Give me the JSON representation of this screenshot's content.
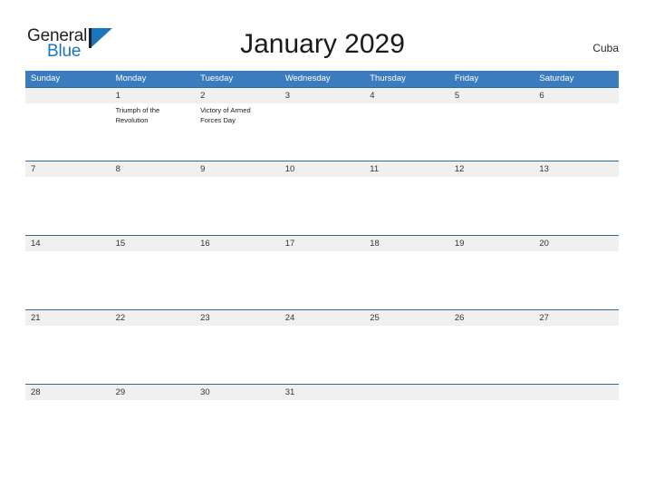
{
  "logo": {
    "word_one": "General",
    "word_two": "Blue",
    "mark_name": "blue-triangle-flag",
    "color_dark": "#231f20",
    "color_blue": "#1b75bc"
  },
  "header": {
    "title": "January 2029",
    "country": "Cuba"
  },
  "colors": {
    "header_blue": "#3b7cbf",
    "row_separator_blue": "#2e6da4",
    "daynum_band": "#f0f0f0",
    "text_dark": "#333333"
  },
  "calendar": {
    "month": "January",
    "year": "2029",
    "weekday_headers": [
      "Sunday",
      "Monday",
      "Tuesday",
      "Wednesday",
      "Thursday",
      "Friday",
      "Saturday"
    ],
    "weeks": [
      {
        "days": [
          {
            "number": "",
            "event": ""
          },
          {
            "number": "1",
            "event": "Triumph of the Revolution"
          },
          {
            "number": "2",
            "event": "Victory of Armed Forces Day"
          },
          {
            "number": "3",
            "event": ""
          },
          {
            "number": "4",
            "event": ""
          },
          {
            "number": "5",
            "event": ""
          },
          {
            "number": "6",
            "event": ""
          }
        ]
      },
      {
        "days": [
          {
            "number": "7",
            "event": ""
          },
          {
            "number": "8",
            "event": ""
          },
          {
            "number": "9",
            "event": ""
          },
          {
            "number": "10",
            "event": ""
          },
          {
            "number": "11",
            "event": ""
          },
          {
            "number": "12",
            "event": ""
          },
          {
            "number": "13",
            "event": ""
          }
        ]
      },
      {
        "days": [
          {
            "number": "14",
            "event": ""
          },
          {
            "number": "15",
            "event": ""
          },
          {
            "number": "16",
            "event": ""
          },
          {
            "number": "17",
            "event": ""
          },
          {
            "number": "18",
            "event": ""
          },
          {
            "number": "19",
            "event": ""
          },
          {
            "number": "20",
            "event": ""
          }
        ]
      },
      {
        "days": [
          {
            "number": "21",
            "event": ""
          },
          {
            "number": "22",
            "event": ""
          },
          {
            "number": "23",
            "event": ""
          },
          {
            "number": "24",
            "event": ""
          },
          {
            "number": "25",
            "event": ""
          },
          {
            "number": "26",
            "event": ""
          },
          {
            "number": "27",
            "event": ""
          }
        ]
      },
      {
        "days": [
          {
            "number": "28",
            "event": ""
          },
          {
            "number": "29",
            "event": ""
          },
          {
            "number": "30",
            "event": ""
          },
          {
            "number": "31",
            "event": ""
          },
          {
            "number": "",
            "event": ""
          },
          {
            "number": "",
            "event": ""
          },
          {
            "number": "",
            "event": ""
          }
        ]
      }
    ]
  }
}
